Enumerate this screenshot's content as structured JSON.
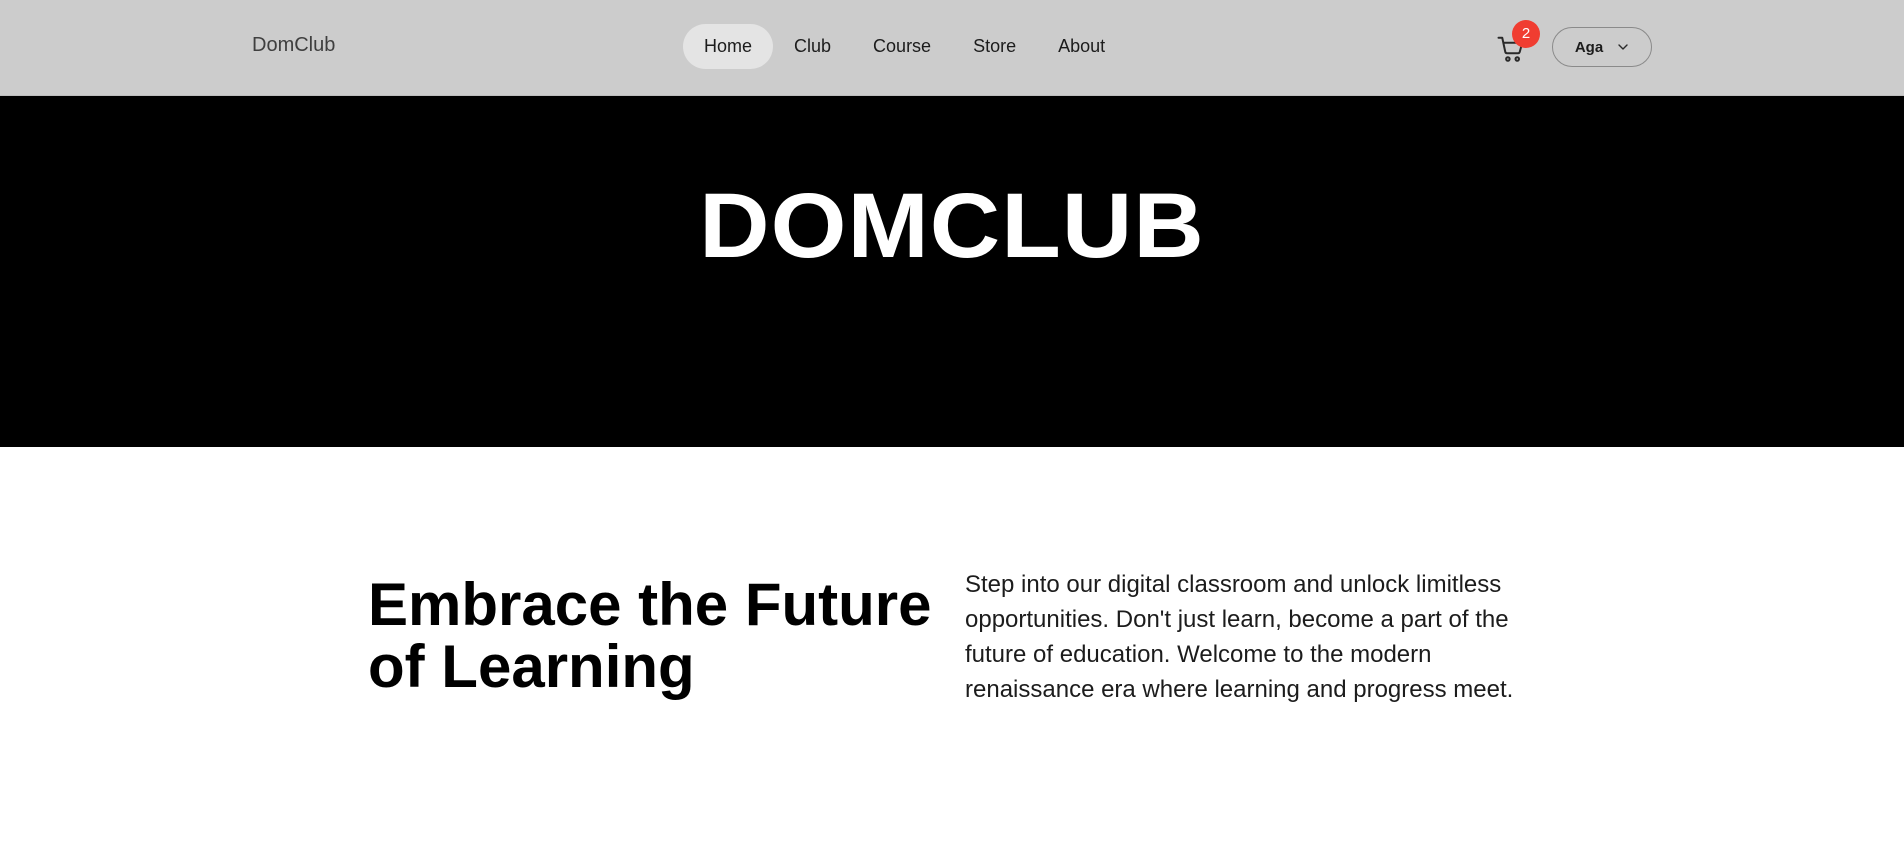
{
  "navbar": {
    "brand": "DomClub",
    "links": [
      {
        "label": "Home",
        "active": true
      },
      {
        "label": "Club",
        "active": false
      },
      {
        "label": "Course",
        "active": false
      },
      {
        "label": "Store",
        "active": false
      },
      {
        "label": "About",
        "active": false
      }
    ],
    "cart": {
      "icon": "cart-icon",
      "count": "2",
      "badge_color": "#f03d31"
    },
    "user": {
      "name": "Aga",
      "icon": "chevron-down-icon"
    }
  },
  "hero": {
    "title": "DOMCLUB"
  },
  "intro": {
    "heading": "Embrace the Future of Learning",
    "text": "Step into our digital classroom and unlock limitless opportunities. Don't just learn, become a part of the future of education. Welcome to the modern renaissance era where learning and progress meet."
  },
  "colors": {
    "navbar_bg": "#cccccc",
    "hero_bg": "#000000",
    "active_link_bg": "#e4e4e4"
  }
}
